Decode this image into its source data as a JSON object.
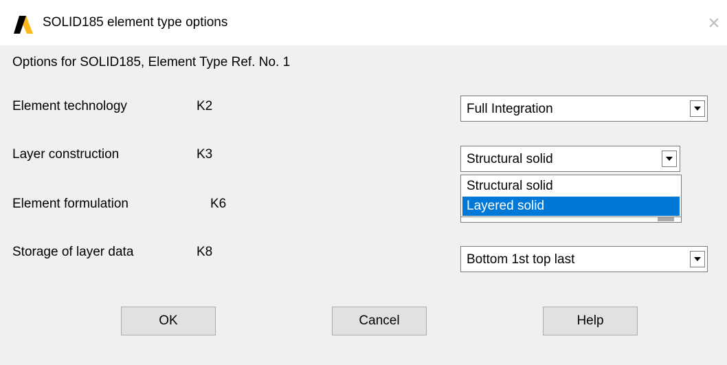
{
  "window": {
    "title": "SOLID185 element type options",
    "close_glyph": "×",
    "icon": "ansys-logo-icon"
  },
  "header": {
    "text": "Options for SOLID185, Element Type Ref. No. 1"
  },
  "options": [
    {
      "label": "Element technology",
      "key": "K2",
      "value": "Full Integration"
    },
    {
      "label": "Layer construction",
      "key": "K3",
      "value": "Structural solid"
    },
    {
      "label": "Element formulation",
      "key": "K6",
      "value": ""
    },
    {
      "label": "Storage of layer data",
      "key": "K8",
      "value": "Bottom 1st top last"
    }
  ],
  "dropdown": {
    "items": [
      "Structural solid",
      "Layered solid"
    ],
    "highlighted": "Layered solid"
  },
  "buttons": {
    "ok": "OK",
    "cancel": "Cancel",
    "help": "Help"
  },
  "colors": {
    "highlight": "#0078d7",
    "logo_yellow": "#ffb71b"
  }
}
